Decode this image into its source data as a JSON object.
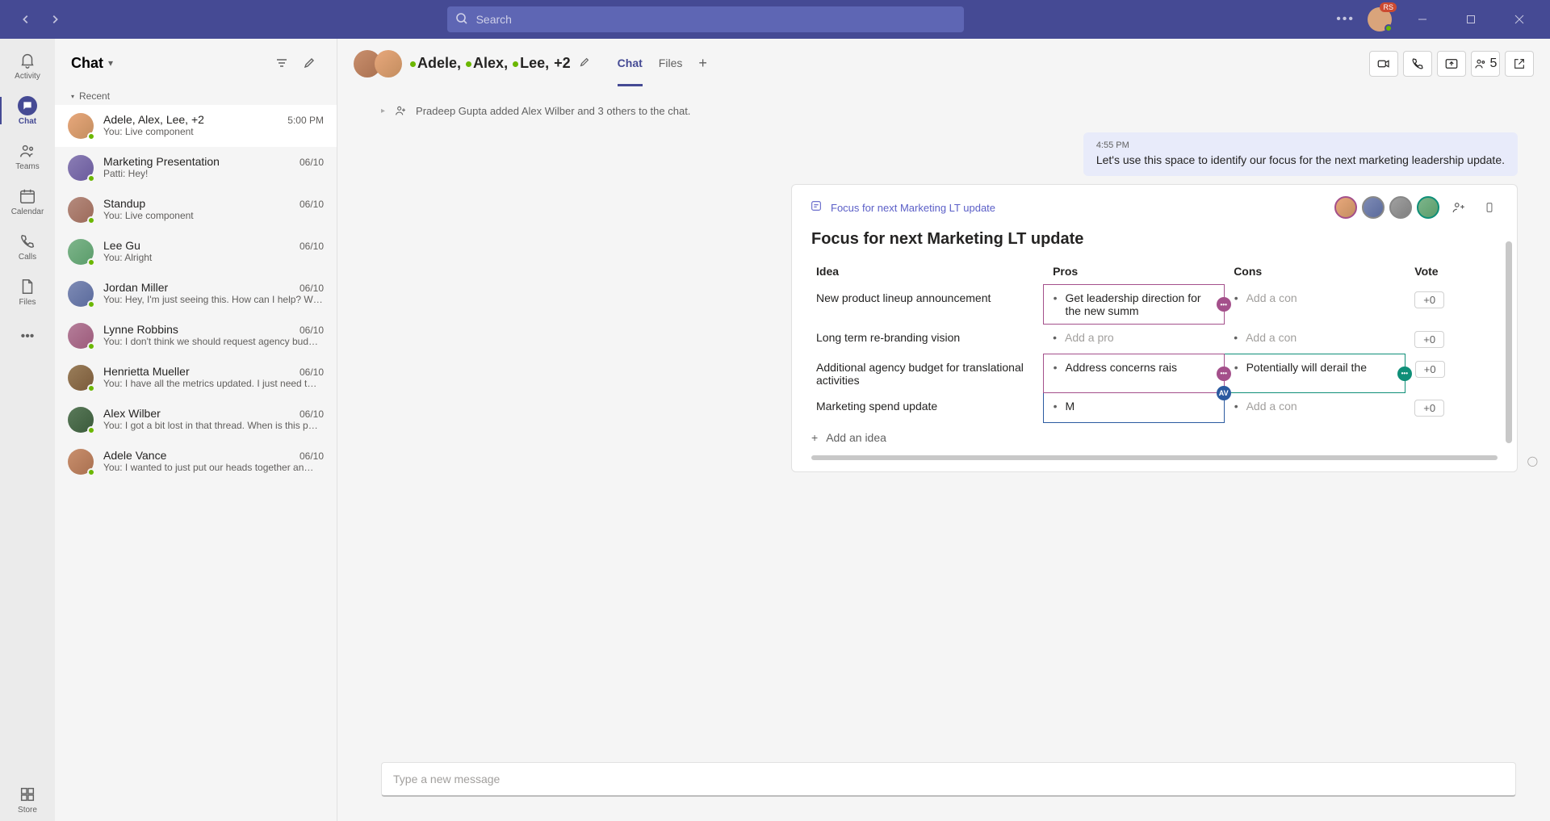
{
  "titlebar": {
    "search_placeholder": "Search",
    "avatar_badge": "RS"
  },
  "rail": [
    {
      "label": "Activity",
      "icon": "bell"
    },
    {
      "label": "Chat",
      "icon": "chat",
      "active": true
    },
    {
      "label": "Teams",
      "icon": "teams"
    },
    {
      "label": "Calendar",
      "icon": "calendar"
    },
    {
      "label": "Calls",
      "icon": "phone"
    },
    {
      "label": "Files",
      "icon": "file"
    },
    {
      "label": "",
      "icon": "more"
    },
    {
      "label": "Store",
      "icon": "store",
      "bottom": true
    }
  ],
  "list": {
    "title": "Chat",
    "section": "Recent",
    "items": [
      {
        "title": "Adele, Alex, Lee, +2",
        "preview": "You: Live component",
        "time": "5:00 PM",
        "active": true,
        "av": "av-a"
      },
      {
        "title": "Marketing Presentation",
        "preview": "Patti: Hey!",
        "time": "06/10",
        "av": "av-b"
      },
      {
        "title": "Standup",
        "preview": "You: Live component",
        "time": "06/10",
        "av": "av-c"
      },
      {
        "title": "Lee Gu",
        "preview": "You: Alright",
        "time": "06/10",
        "av": "av-d"
      },
      {
        "title": "Jordan Miller",
        "preview": "You: Hey, I'm just seeing this. How can I help? W…",
        "time": "06/10",
        "av": "av-e"
      },
      {
        "title": "Lynne Robbins",
        "preview": "You: I don't think we should request agency bud…",
        "time": "06/10",
        "av": "av-f"
      },
      {
        "title": "Henrietta Mueller",
        "preview": "You: I have all the metrics updated. I just need t…",
        "time": "06/10",
        "av": "av-g"
      },
      {
        "title": "Alex Wilber",
        "preview": "You: I got a bit lost in that thread. When is this p…",
        "time": "06/10",
        "av": "av-h"
      },
      {
        "title": "Adele Vance",
        "preview": "You: I wanted to just put our heads together an…",
        "time": "06/10",
        "av": "av-i"
      }
    ]
  },
  "chat": {
    "participants": [
      {
        "name": "Adele"
      },
      {
        "name": "Alex"
      },
      {
        "name": "Lee"
      }
    ],
    "extra": "+2",
    "tabs": [
      {
        "label": "Chat",
        "active": true
      },
      {
        "label": "Files"
      }
    ],
    "people_count": "5",
    "system_msg": "Pradeep Gupta added Alex Wilber and 3 others to the chat.",
    "message": {
      "time": "4:55 PM",
      "text": "Let's use this space to identify our focus for the next marketing leadership update."
    },
    "component": {
      "link_text": "Focus for next Marketing LT update",
      "title": "Focus for next Marketing LT update",
      "headers": {
        "idea": "Idea",
        "pros": "Pros",
        "cons": "Cons",
        "vote": "Vote"
      },
      "rows": [
        {
          "idea": "New product lineup announcement",
          "pro": "Get leadership direction for the new summ",
          "con": "Add a con",
          "con_ph": true,
          "vote": "+0",
          "pro_border": "magenta"
        },
        {
          "idea": "Long term re-branding vision",
          "pro": "Add a pro",
          "pro_ph": true,
          "con": "Add a con",
          "con_ph": true,
          "vote": "+0"
        },
        {
          "idea": "Additional agency budget for translational activities",
          "pro": "Address concerns rais",
          "con": "Potentially will derail the",
          "vote": "+0",
          "pro_border": "magenta",
          "con_border": "teal"
        },
        {
          "idea": "Marketing spend update",
          "pro": "M",
          "con": "Add a con",
          "con_ph": true,
          "vote": "+0",
          "pro_border": "blue"
        }
      ],
      "add_row": "Add an idea"
    },
    "composer_placeholder": "Type a new message"
  }
}
